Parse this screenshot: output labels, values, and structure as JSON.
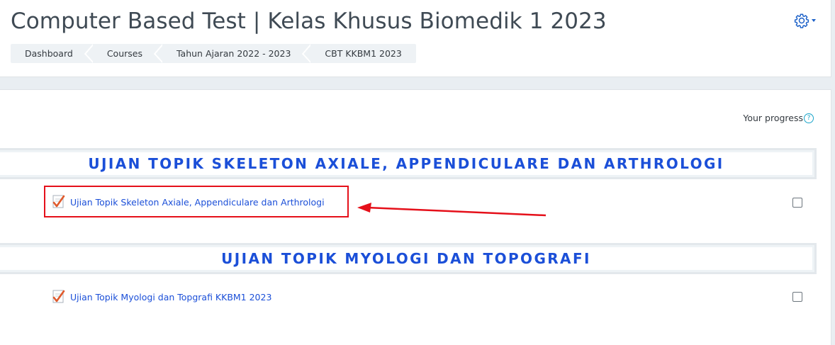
{
  "header": {
    "title": "Computer Based Test | Kelas Khusus Biomedik 1 2023",
    "breadcrumb": [
      "Dashboard",
      "Courses",
      "Tahun Ajaran 2022 - 2023",
      "CBT KKBM1 2023"
    ]
  },
  "progress": {
    "label": "Your progress",
    "help_glyph": "?"
  },
  "sections": [
    {
      "title": "UJIAN TOPIK SKELETON AXIALE, APPENDICULARE DAN ARTHROLOGI",
      "activity": {
        "label": "Ujian Topik Skeleton Axiale, Appendiculare dan Arthrologi",
        "icon": "quiz-icon",
        "completed": false
      }
    },
    {
      "title": "UJIAN TOPIK MYOLOGI DAN TOPOGRAFI",
      "activity": {
        "label": "Ujian Topik Myologi dan Topgrafi KKBM1 2023",
        "icon": "quiz-icon",
        "completed": false
      }
    }
  ],
  "colors": {
    "accent": "#1b4fd8",
    "annotation": "#e5101a",
    "title": "#3f4a54"
  }
}
